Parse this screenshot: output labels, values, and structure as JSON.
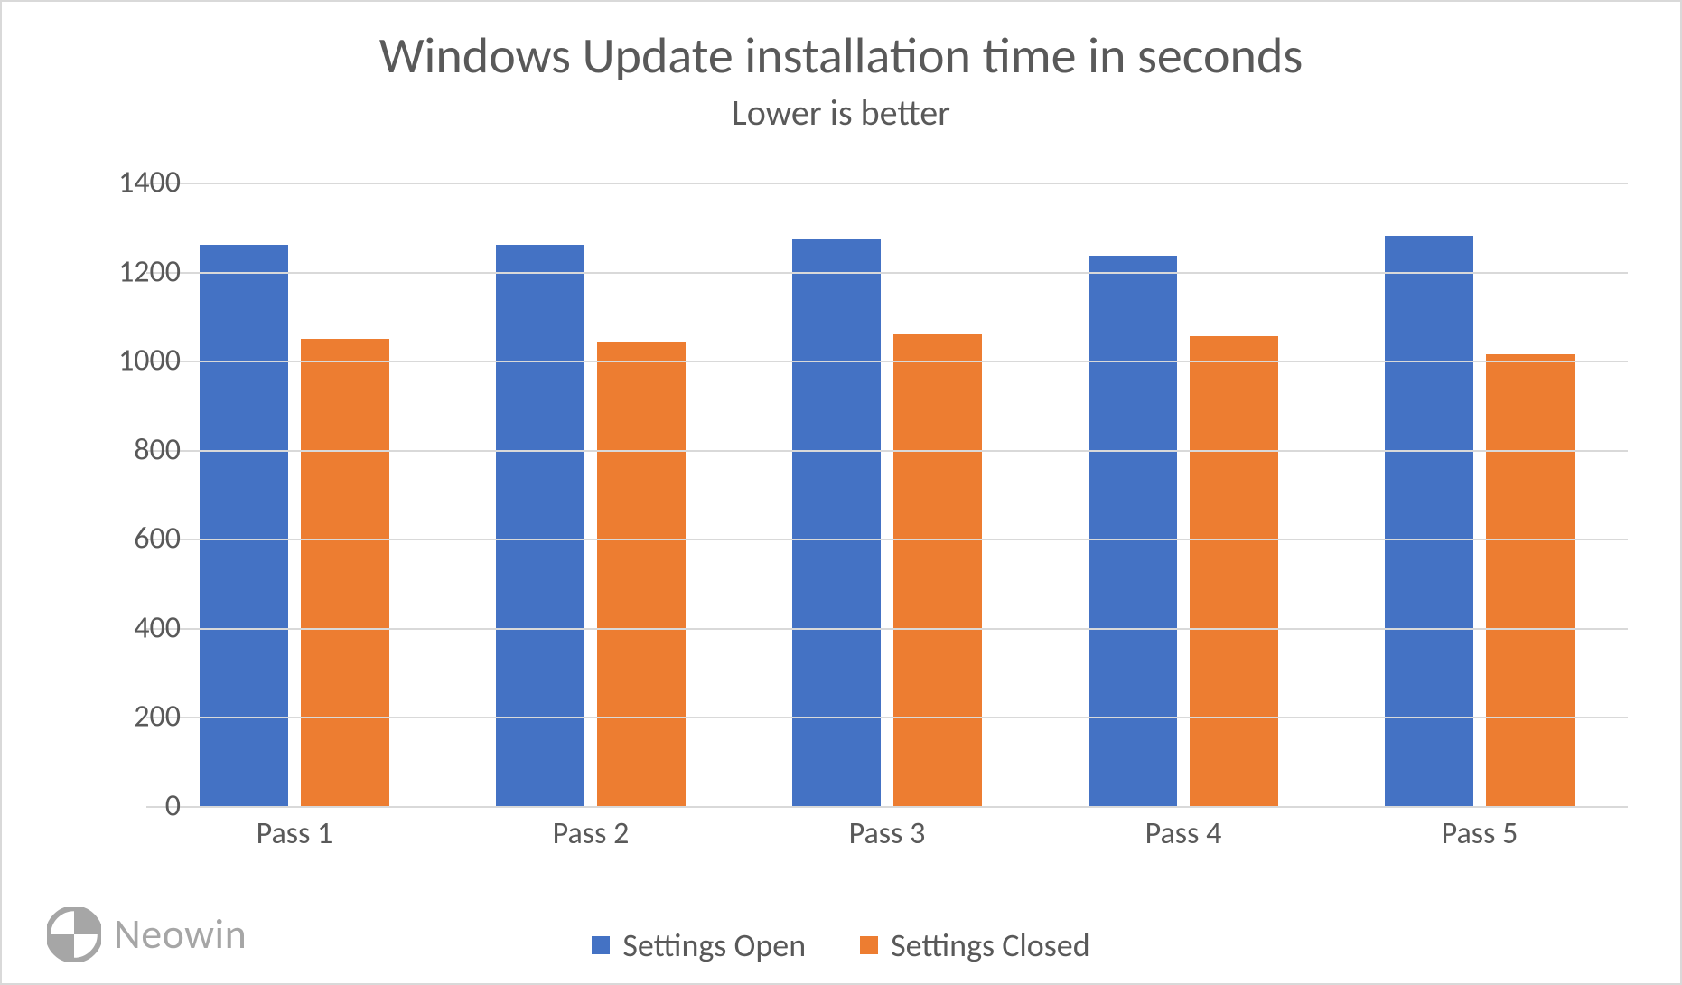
{
  "chart_data": {
    "type": "bar",
    "title": "Windows Update installation time in seconds",
    "subtitle": "Lower is better",
    "xlabel": "",
    "ylabel": "",
    "ylim": [
      0,
      1400
    ],
    "ytick_step": 200,
    "categories": [
      "Pass 1",
      "Pass 2",
      "Pass 3",
      "Pass 4",
      "Pass 5"
    ],
    "series": [
      {
        "name": "Settings Open",
        "color": "#4472c4",
        "values": [
          1260,
          1260,
          1275,
          1235,
          1280
        ]
      },
      {
        "name": "Settings Closed",
        "color": "#ed7d31",
        "values": [
          1050,
          1040,
          1060,
          1055,
          1015
        ]
      }
    ],
    "legend_position": "bottom",
    "grid": true
  },
  "watermark": {
    "text": "Neowin"
  }
}
